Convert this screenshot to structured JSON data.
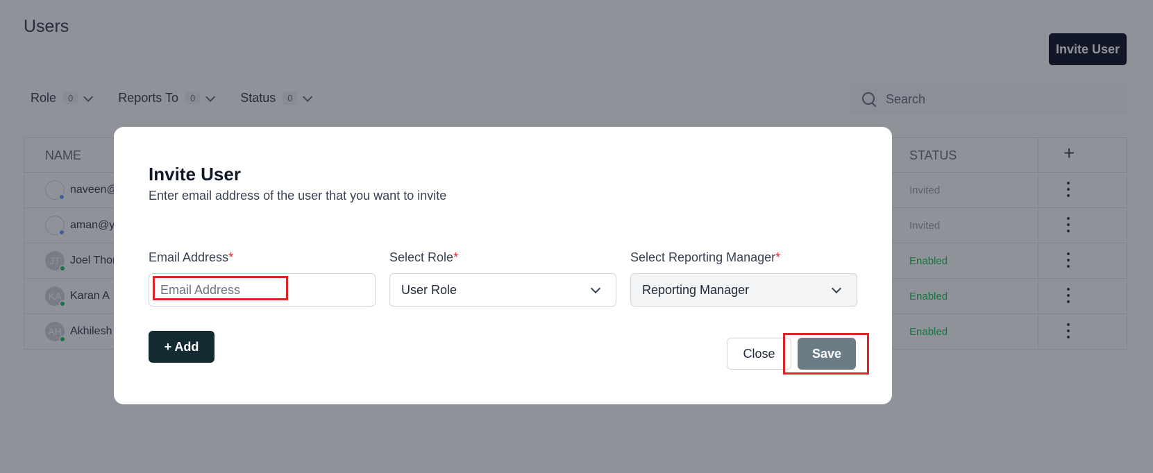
{
  "page": {
    "title": "Users",
    "invite_button": "Invite User",
    "filters": [
      {
        "label": "Role",
        "count": "0"
      },
      {
        "label": "Reports To",
        "count": "0"
      },
      {
        "label": "Status",
        "count": "0"
      }
    ],
    "search_placeholder": "Search"
  },
  "table": {
    "headers": {
      "name": "NAME",
      "status": "STATUS"
    },
    "rows": [
      {
        "initials": "",
        "name": "naveen@",
        "status": "Invited",
        "status_color": "#9ca3af",
        "dot_color": "#60a5fa"
      },
      {
        "initials": "",
        "name": "aman@yo",
        "status": "Invited",
        "status_color": "#9ca3af",
        "dot_color": "#60a5fa"
      },
      {
        "initials": "JT",
        "name": "Joel Thor",
        "status": "Enabled",
        "status_color": "#22c55e",
        "dot_color": "#22c55e"
      },
      {
        "initials": "KA",
        "name": "Karan A",
        "status": "Enabled",
        "status_color": "#22c55e",
        "dot_color": "#22c55e"
      },
      {
        "initials": "AH",
        "name": "Akhilesh",
        "status": "Enabled",
        "status_color": "#22c55e",
        "dot_color": "#22c55e"
      }
    ]
  },
  "modal": {
    "title": "Invite User",
    "subtitle": "Enter email address of the user that you want to invite",
    "fields": {
      "email": {
        "label": "Email Address",
        "required_mark": "*",
        "placeholder": "Email Address"
      },
      "role": {
        "label": "Select Role",
        "required_mark": "*",
        "value": "User Role"
      },
      "manager": {
        "label": "Select Reporting Manager",
        "required_mark": "*",
        "value": "Reporting Manager"
      }
    },
    "add_button": "+ Add",
    "close_button": "Close",
    "save_button": "Save"
  },
  "colors": {
    "primary_dark": "#132a31",
    "save_disabled": "#6b7c86",
    "highlight": "#dc2626",
    "required": "#dc2626"
  }
}
